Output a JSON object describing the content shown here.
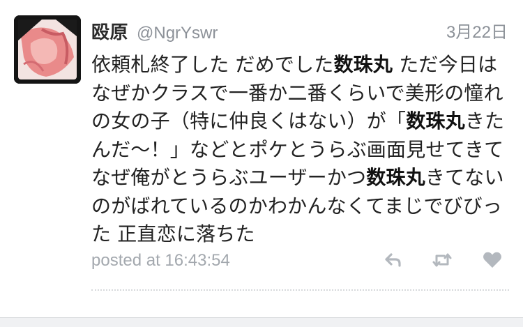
{
  "tweet": {
    "display_name": "殴原",
    "handle": "@NgrYswr",
    "date": "3月22日",
    "text_segments": [
      {
        "text": "依頼札終了した だめでした",
        "bold": false
      },
      {
        "text": "数珠丸",
        "bold": true
      },
      {
        "text": " ただ今日はなぜかクラスで一番か二番くらいで美形の憧れの女の子（特に仲良くはない）が「",
        "bold": false
      },
      {
        "text": "数珠丸",
        "bold": true
      },
      {
        "text": "きたんだ〜！」などとポケとうらぶ画面見せてきてなぜ俺がとうらぶユーザーかつ",
        "bold": false
      },
      {
        "text": "数珠丸",
        "bold": true
      },
      {
        "text": "きてないのがばれているのかわかんなくてまじでびびった 正直恋に落ちた",
        "bold": false
      }
    ],
    "posted_at": "posted at 16:43:54"
  },
  "actions": {
    "reply_icon": "reply-icon",
    "retweet_icon": "retweet-icon",
    "like_icon": "heart-icon"
  },
  "colors": {
    "muted_text": "#8c9198",
    "icon": "#b3b8be",
    "divider": "#d7d9dc"
  }
}
